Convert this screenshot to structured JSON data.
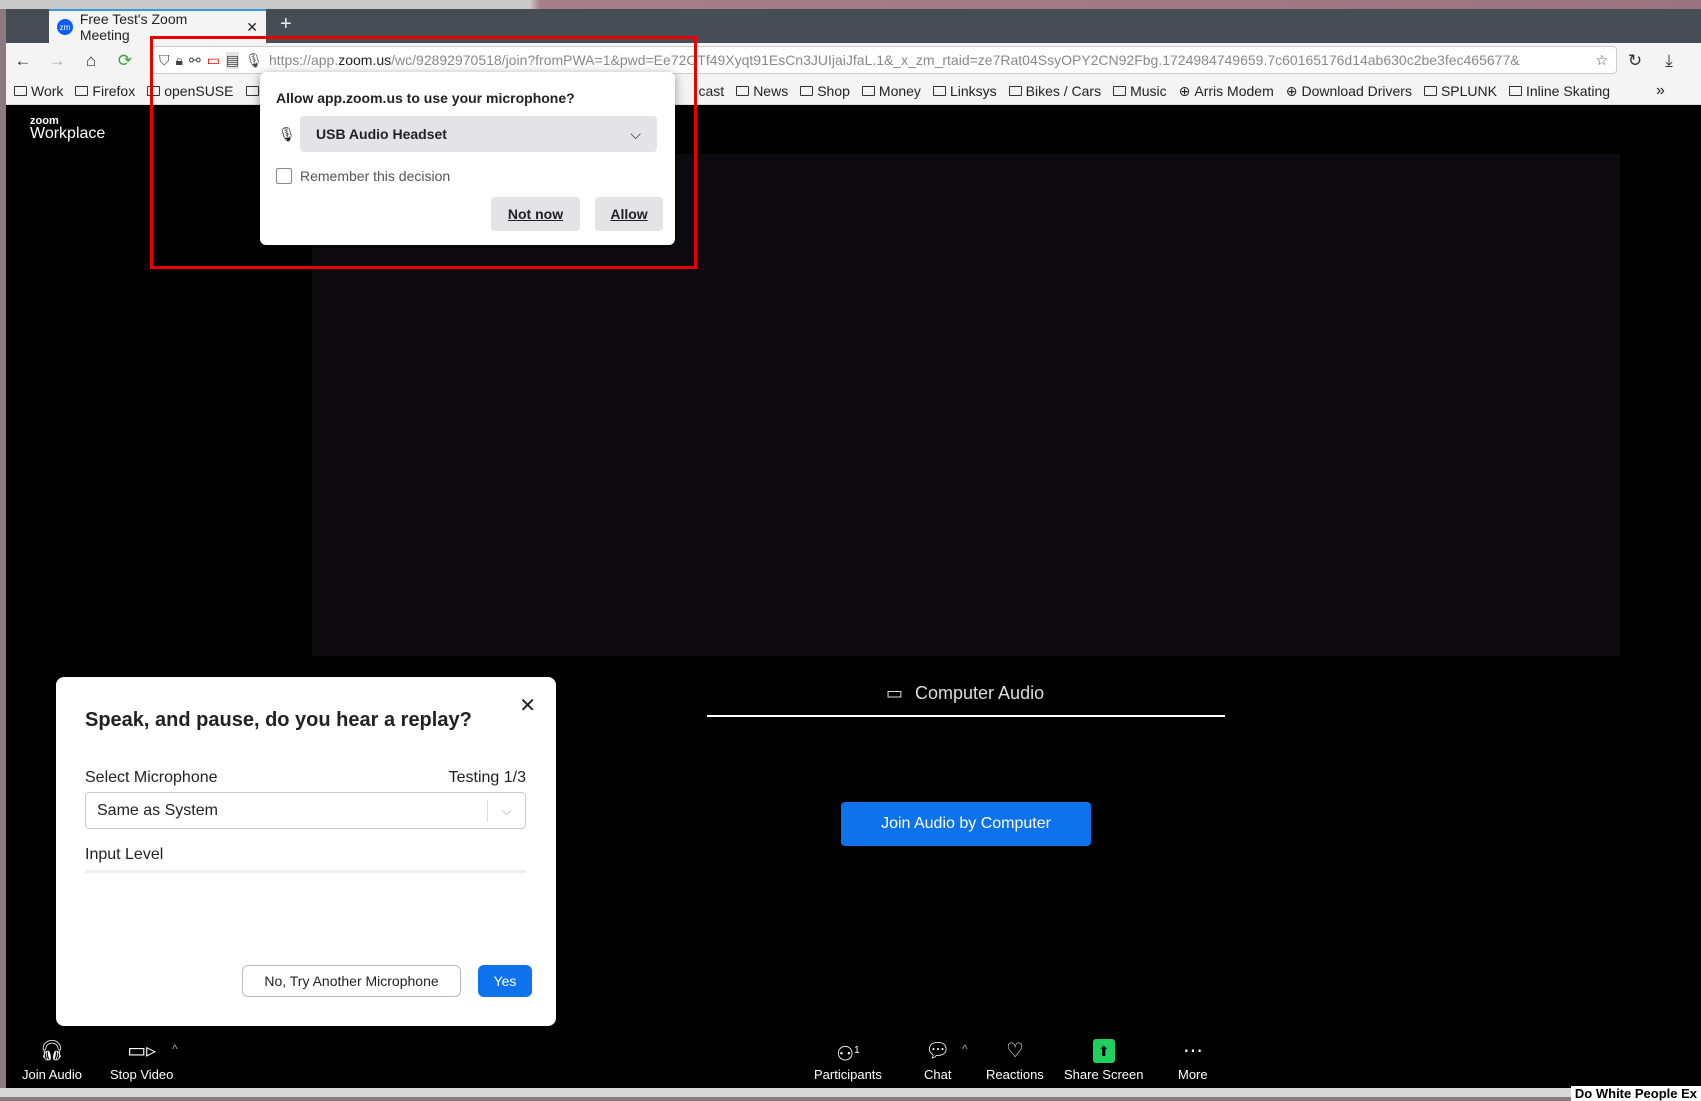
{
  "browser": {
    "tab_title": "Free Test's Zoom Meeting",
    "tab_favicon": "zm",
    "url_domain_prefix": "https://app.",
    "url_domain": "zoom.us",
    "url_rest": "/wc/92892970518/join?fromPWA=1&pwd=Ee72OTf49Xyqt91EsCn3JUIjaiJfaL.1&_x_zm_rtaid=ze7Rat04SsyOPY2CN92Fbg.1724984749659.7c60165176d14ab630c2be3fec465677&",
    "bookmarks": [
      "Work",
      "Firefox",
      "openSUSE",
      "",
      "cast",
      "News",
      "Shop",
      "Money",
      "Linksys",
      "Bikes / Cars",
      "Music",
      "Arris Modem",
      "Download Drivers",
      "SPLUNK",
      "Inline Skating"
    ]
  },
  "permission": {
    "question": "Allow app.zoom.us to use your microphone?",
    "device": "USB Audio Headset",
    "remember": "Remember this decision",
    "not_now": "Not now",
    "allow": "Allow"
  },
  "zoom": {
    "logo_small": "zoom",
    "logo_big": "Workplace",
    "audio_tab": "Computer Audio",
    "join_button": "Join Audio by Computer"
  },
  "dialog": {
    "title": "Speak, and pause, do you hear a replay?",
    "select_label": "Select Microphone",
    "testing": "Testing 1/3",
    "mic_value": "Same as System",
    "input_level": "Input Level",
    "no_button": "No, Try Another Microphone",
    "yes_button": "Yes"
  },
  "toolbar": {
    "join_audio": "Join Audio",
    "stop_video": "Stop Video",
    "participants": "Participants",
    "participant_count": "1",
    "chat": "Chat",
    "reactions": "Reactions",
    "share_screen": "Share Screen",
    "more": "More"
  },
  "taskbar": {
    "news": "Do White People Ex"
  },
  "colors": {
    "accent": "#0e72ed",
    "share": "#1fd05e",
    "highlight": "#e60000"
  }
}
